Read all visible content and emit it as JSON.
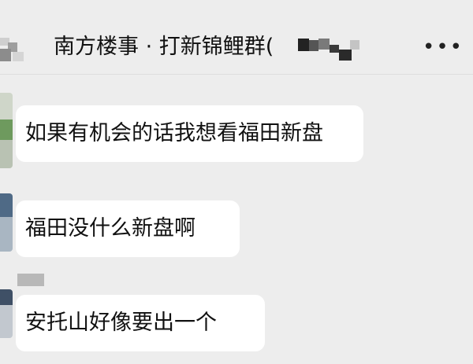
{
  "header": {
    "title": "南方楼事 · 打新锦鲤群(",
    "more_icon": "more-icon",
    "back_icon": "back-icon"
  },
  "messages": [
    {
      "text": "如果有机会的话我想看福田新盘"
    },
    {
      "text": "福田没什么新盘啊"
    },
    {
      "text": "安托山好像要出一个"
    }
  ],
  "colors": {
    "background": "#ededed",
    "bubble": "#ffffff",
    "text": "#111111"
  }
}
